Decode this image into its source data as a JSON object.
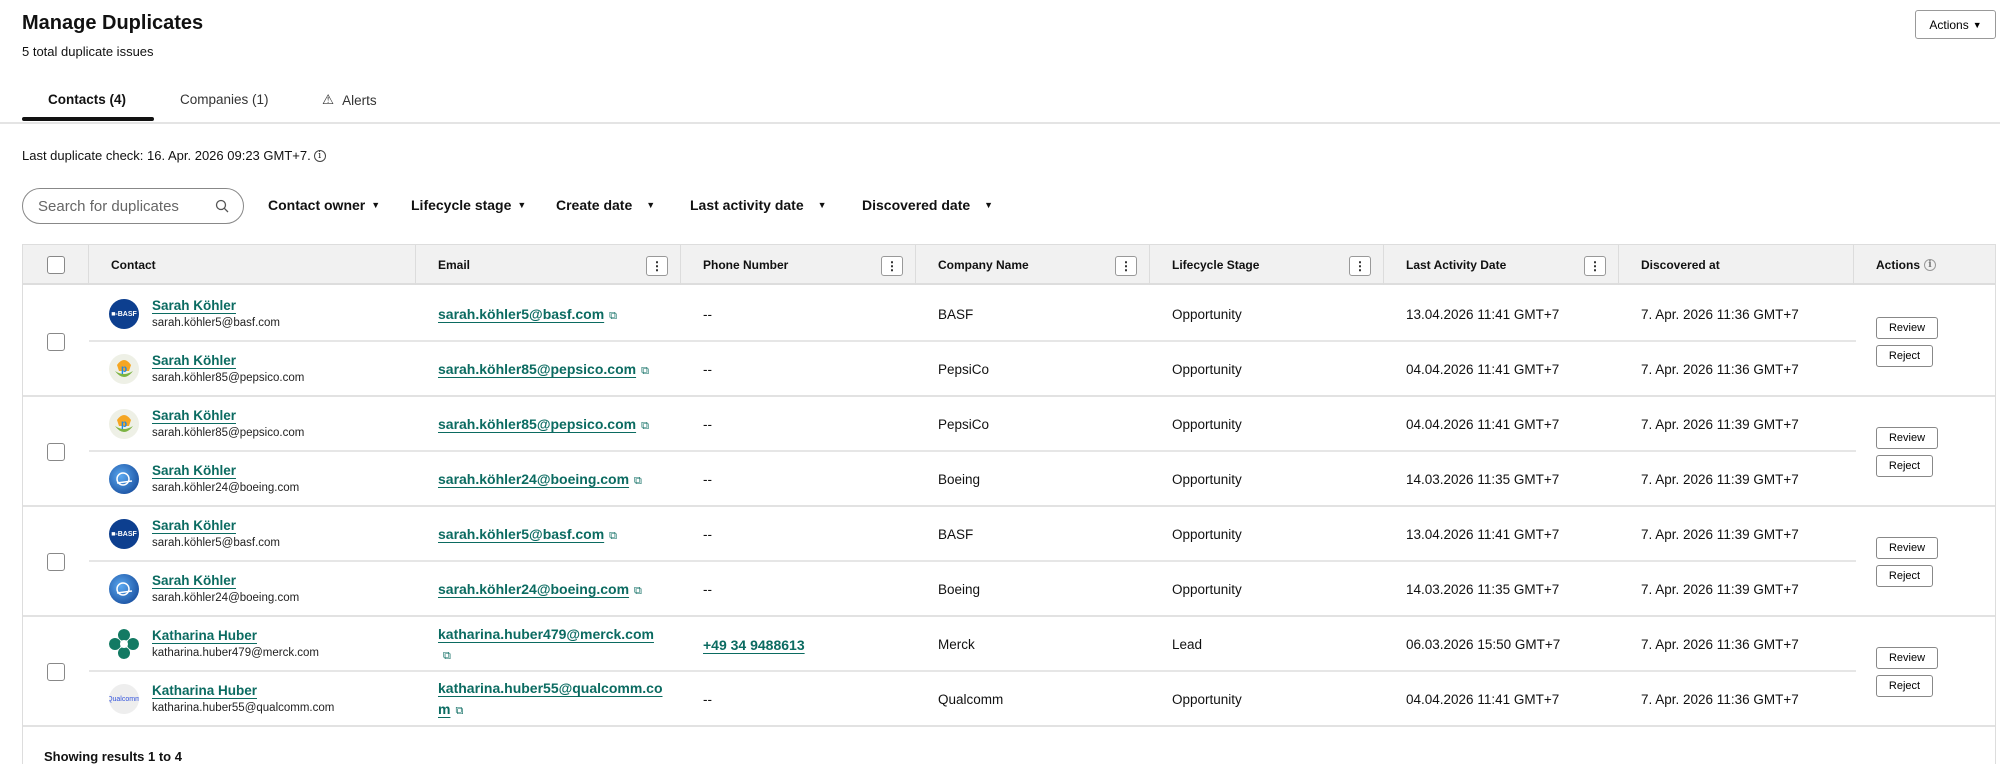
{
  "header": {
    "title": "Manage Duplicates",
    "subtitle": "5 total duplicate issues",
    "actions_label": "Actions"
  },
  "tabs": [
    {
      "label": "Contacts (4)"
    },
    {
      "label": "Companies (1)"
    },
    {
      "label": "Alerts"
    }
  ],
  "last_check": "Last duplicate check: 16. Apr. 2026 09:23 GMT+7.",
  "search": {
    "placeholder": "Search for duplicates"
  },
  "filters": [
    "Contact owner",
    "Lifecycle stage",
    "Create date",
    "Last activity date",
    "Discovered date"
  ],
  "columns": [
    "Contact",
    "Email",
    "Phone Number",
    "Company Name",
    "Lifecycle Stage",
    "Last Activity Date",
    "Discovered at",
    "Actions"
  ],
  "review_label": "Review",
  "reject_label": "Reject",
  "groups": [
    {
      "rows": [
        {
          "name": "Sarah Köhler",
          "email": "sarah.köhler5@basf.com",
          "logo": "BASF",
          "phone": "--",
          "company": "BASF",
          "stage": "Opportunity",
          "last_activity": "13.04.2026 11:41 GMT+7",
          "discovered": "7. Apr. 2026 11:36 GMT+7"
        },
        {
          "name": "Sarah Köhler",
          "email": "sarah.köhler85@pepsico.com",
          "logo": "pepsico",
          "phone": "--",
          "company": "PepsiCo",
          "stage": "Opportunity",
          "last_activity": "04.04.2026 11:41 GMT+7",
          "discovered": "7. Apr. 2026 11:36 GMT+7"
        }
      ]
    },
    {
      "rows": [
        {
          "name": "Sarah Köhler",
          "email": "sarah.köhler85@pepsico.com",
          "logo": "pepsico",
          "phone": "--",
          "company": "PepsiCo",
          "stage": "Opportunity",
          "last_activity": "04.04.2026 11:41 GMT+7",
          "discovered": "7. Apr. 2026 11:39 GMT+7"
        },
        {
          "name": "Sarah Köhler",
          "email": "sarah.köhler24@boeing.com",
          "logo": "boeing",
          "phone": "--",
          "company": "Boeing",
          "stage": "Opportunity",
          "last_activity": "14.03.2026 11:35 GMT+7",
          "discovered": "7. Apr. 2026 11:39 GMT+7"
        }
      ]
    },
    {
      "rows": [
        {
          "name": "Sarah Köhler",
          "email": "sarah.köhler5@basf.com",
          "logo": "BASF",
          "phone": "--",
          "company": "BASF",
          "stage": "Opportunity",
          "last_activity": "13.04.2026 11:41 GMT+7",
          "discovered": "7. Apr. 2026 11:39 GMT+7"
        },
        {
          "name": "Sarah Köhler",
          "email": "sarah.köhler24@boeing.com",
          "logo": "boeing",
          "phone": "--",
          "company": "Boeing",
          "stage": "Opportunity",
          "last_activity": "14.03.2026 11:35 GMT+7",
          "discovered": "7. Apr. 2026 11:39 GMT+7"
        }
      ]
    },
    {
      "rows": [
        {
          "name": "Katharina Huber",
          "email": "katharina.huber479@merck.com",
          "logo": "merck",
          "phone": "+49 34 9488613",
          "company": "Merck",
          "stage": "Lead",
          "last_activity": "06.03.2026 15:50 GMT+7",
          "discovered": "7. Apr. 2026 11:36 GMT+7"
        },
        {
          "name": "Katharina Huber",
          "email": "katharina.huber55@qualcomm.com",
          "logo": "Qualcomm",
          "phone": "--",
          "company": "Qualcomm",
          "stage": "Opportunity",
          "last_activity": "04.04.2026 11:41 GMT+7",
          "discovered": "7. Apr. 2026 11:36 GMT+7"
        }
      ]
    }
  ],
  "footer": "Showing results 1 to 4",
  "colors": {
    "link": "#0b6b61",
    "header_bg": "#f1f1f1"
  }
}
